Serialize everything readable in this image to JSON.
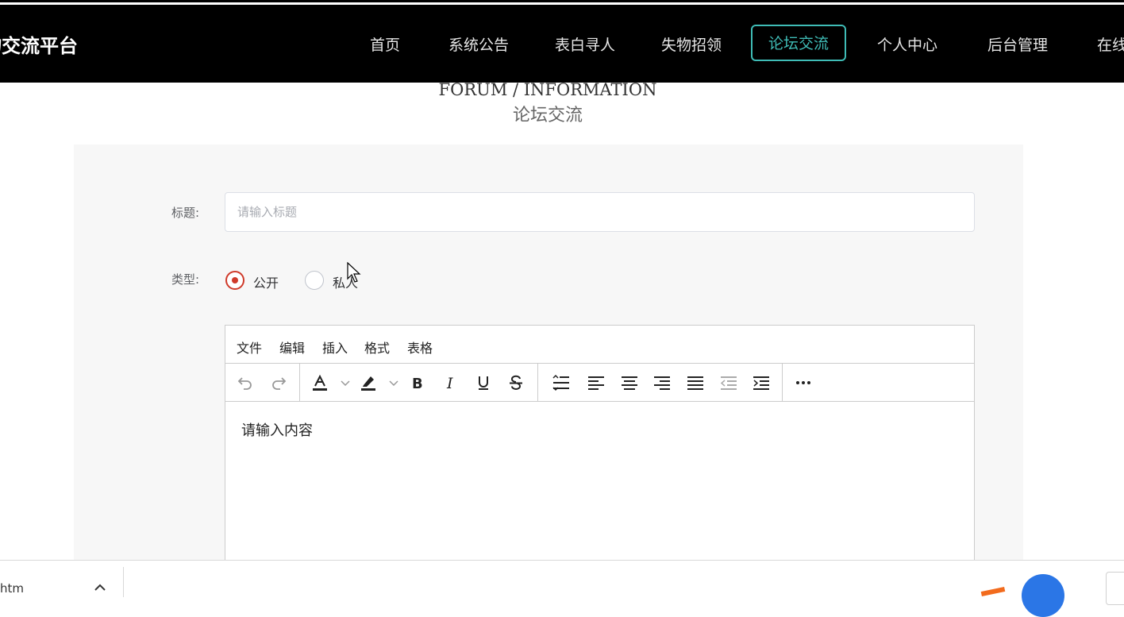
{
  "navbar": {
    "brand": "物交流平台",
    "items": [
      {
        "label": "首页"
      },
      {
        "label": "系统公告"
      },
      {
        "label": "表白寻人"
      },
      {
        "label": "失物招领"
      },
      {
        "label": "论坛交流",
        "active": true
      },
      {
        "label": "个人中心"
      },
      {
        "label": "后台管理"
      },
      {
        "label": "在线"
      }
    ],
    "active_color": "#3fbcb6"
  },
  "section": {
    "title_en": "FORUM / INFORMATION",
    "title_cn": "论坛交流"
  },
  "form": {
    "title_label": "标题:",
    "title_placeholder": "请输入标题",
    "title_value": "",
    "type_label": "类型:",
    "type_options": [
      {
        "label": "公开",
        "checked": true
      },
      {
        "label": "私人",
        "checked": false
      }
    ],
    "accent_color": "#cf3a2a"
  },
  "editor": {
    "menus": [
      "文件",
      "编辑",
      "插入",
      "格式",
      "表格"
    ],
    "toolbar_icons": [
      "undo-icon",
      "redo-icon",
      "text-color-icon",
      "chevron-down-icon",
      "highlight-icon",
      "chevron-down-icon",
      "bold-icon",
      "italic-icon",
      "underline-icon",
      "strikethrough-icon",
      "line-height-icon",
      "align-left-icon",
      "align-center-icon",
      "align-right-icon",
      "align-justify-icon",
      "outdent-icon",
      "indent-icon",
      "more-icon"
    ],
    "placeholder": "请输入内容"
  },
  "download_bar": {
    "file_name": "htm"
  }
}
